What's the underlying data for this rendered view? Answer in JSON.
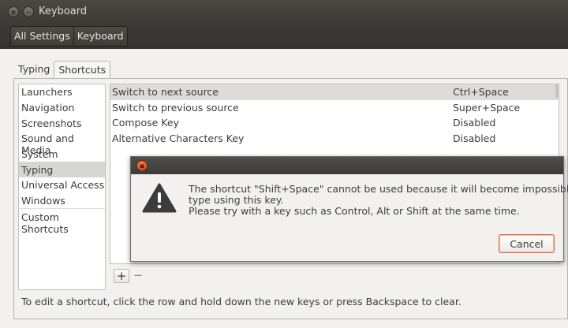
{
  "window": {
    "title": "Keyboard",
    "breadcrumbs": [
      "All Settings",
      "Keyboard"
    ]
  },
  "tabs": [
    "Typing",
    "Shortcuts"
  ],
  "categories": {
    "items": [
      "Launchers",
      "Navigation",
      "Screenshots",
      "Sound and Media",
      "System",
      "Typing",
      "Universal Access",
      "Windows"
    ],
    "selected": "Typing",
    "custom": "Custom Shortcuts"
  },
  "shortcuts": [
    {
      "name": "Switch to next source",
      "accel": "Ctrl+Space"
    },
    {
      "name": "Switch to previous source",
      "accel": "Super+Space"
    },
    {
      "name": "Compose Key",
      "accel": "Disabled"
    },
    {
      "name": "Alternative Characters Key",
      "accel": "Disabled"
    }
  ],
  "buttons": {
    "add": "+",
    "remove": "−"
  },
  "hint": "To edit a shortcut, click the row and hold down the new keys or press Backspace to clear.",
  "dialog": {
    "message_lines": [
      "The shortcut \"Shift+Space\" cannot be used because it will become impossible to",
      "type using this key.",
      "Please try with a key such as Control, Alt or Shift at the same time."
    ],
    "cancel": "Cancel",
    "icon": "warning-icon"
  },
  "colors": {
    "accent": "#e2673f",
    "titlebar": "#3c3b37"
  }
}
